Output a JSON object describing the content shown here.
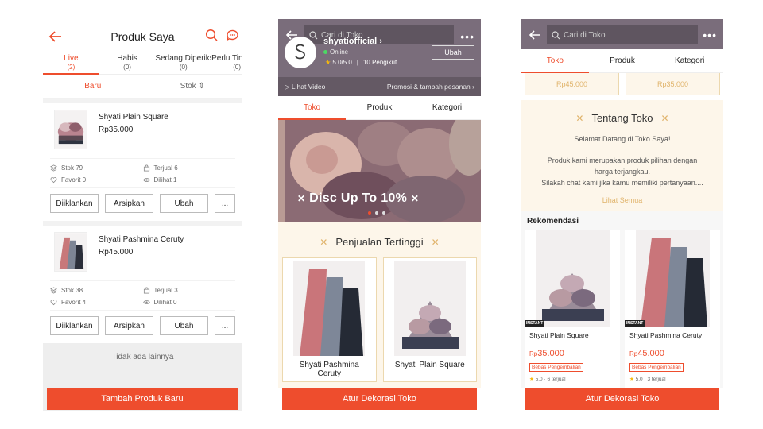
{
  "screen1": {
    "title": "Produk Saya",
    "tabs": [
      {
        "label": "Live",
        "count": "(2)"
      },
      {
        "label": "Habis",
        "count": "(0)"
      },
      {
        "label": "Sedang Diperiksa",
        "count": "(0)"
      },
      {
        "label": "Perlu Tindakan",
        "count": "(0)"
      }
    ],
    "sort": {
      "left": "Baru",
      "right": "Stok ⇕"
    },
    "products": [
      {
        "name": "Shyati Plain Square",
        "price": "Rp35.000",
        "stok": "Stok 79",
        "terjual": "Terjual 6",
        "favorit": "Favorit 0",
        "dilihat": "Dilihat 1"
      },
      {
        "name": "Shyati Pashmina Ceruty",
        "price": "Rp45.000",
        "stok": "Stok 38",
        "terjual": "Terjual 3",
        "favorit": "Favorit 4",
        "dilihat": "Dilihat 0"
      }
    ],
    "actions": {
      "promote": "Diiklankan",
      "archive": "Arsipkan",
      "edit": "Ubah",
      "more": "..."
    },
    "empty_text": "Tidak ada lainnya",
    "add_button": "Tambah Produk Baru"
  },
  "screen2": {
    "search_placeholder": "Cari di Toko",
    "shop_name": "shyatiofficial",
    "online": "Online",
    "rating": "5.0/5.0",
    "followers": "10 Pengikut",
    "edit_button": "Ubah",
    "video_label": "Lihat Video",
    "promo_label": "Promosi & tambah pesanan",
    "tabs": [
      "Toko",
      "Produk",
      "Kategori"
    ],
    "banner_text": "Disc Up To 10%",
    "section_title": "Penjualan Tertinggi",
    "cards": [
      {
        "name": "Shyati Pashmina Ceruty"
      },
      {
        "name": "Shyati Plain Square"
      }
    ],
    "decorate_button": "Atur Dekorasi Toko"
  },
  "screen3": {
    "search_placeholder": "Cari di Toko",
    "tabs": [
      "Toko",
      "Produk",
      "Kategori"
    ],
    "prices": [
      "Rp45.000",
      "Rp35.000"
    ],
    "about_title": "Tentang Toko",
    "about_line1": "Selamat Datang di Toko Saya!",
    "about_line2": "Produk kami merupakan produk pilihan dengan",
    "about_line3": "harga terjangkau.",
    "about_line4": "Silakah chat kami jika kamu memiliki pertanyaan....",
    "see_all": "Lihat Semua",
    "reko_title": "Rekomendasi",
    "reko": [
      {
        "name": "Shyati Plain Square",
        "currency": "Rp",
        "price": "35.000",
        "tag": "Bebas Pengembalian",
        "sold": "5.0 · 6 terjual",
        "badge": "INSTANT"
      },
      {
        "name": "Shyati Pashmina Ceruty",
        "currency": "Rp",
        "price": "45.000",
        "tag": "Bebas Pengembalian",
        "sold": "5.0 · 3 terjual",
        "badge": "INSTANT"
      }
    ],
    "decorate_button": "Atur Dekorasi Toko"
  },
  "colors": {
    "accent": "#ee4d2d",
    "header_purple": "#7a6d7b",
    "cream": "#fdf6ea",
    "gold": "#e0b36a"
  }
}
